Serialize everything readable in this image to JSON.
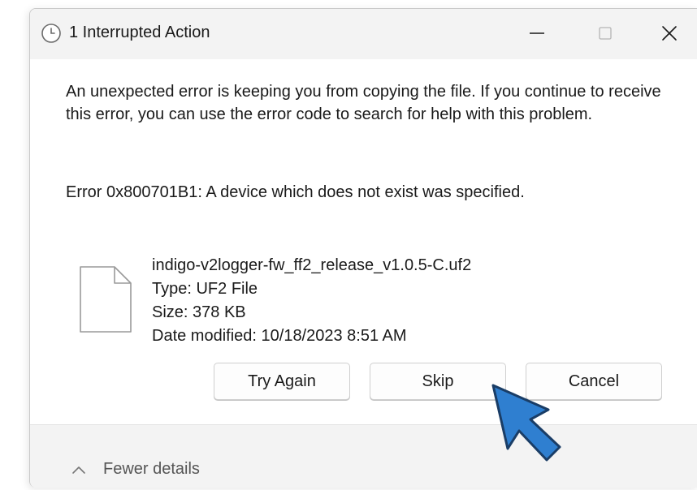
{
  "window": {
    "title": "1 Interrupted Action",
    "title_icon": "clock-icon",
    "minimize_icon": "minimize-icon",
    "maximize_icon": "maximize-icon",
    "close_icon": "close-icon"
  },
  "message": {
    "body": "An unexpected error is keeping you from copying the file. If you continue to receive this error, you can use the error code to search for help with this problem.",
    "error": "Error 0x800701B1: A device which does not exist was specified."
  },
  "file": {
    "icon": "file-icon",
    "name": "indigo-v2logger-fw_ff2_release_v1.0.5-C.uf2",
    "type": "Type: UF2 File",
    "size": "Size: 378 KB",
    "date_modified": "Date modified: 10/18/2023 8:51 AM"
  },
  "buttons": {
    "try_again": "Try Again",
    "skip": "Skip",
    "cancel": "Cancel"
  },
  "footer": {
    "details_label": "Fewer details",
    "details_icon": "chevron-up-icon"
  },
  "overlay": {
    "pointer_icon": "pointer-arrow-icon",
    "pointer_color": "#2f7fd0"
  },
  "colors": {
    "titlebar_bg": "#f3f3f3",
    "footer_bg": "#f3f3f3",
    "button_border": "#cfcfcf",
    "text": "#1a1a1a"
  }
}
